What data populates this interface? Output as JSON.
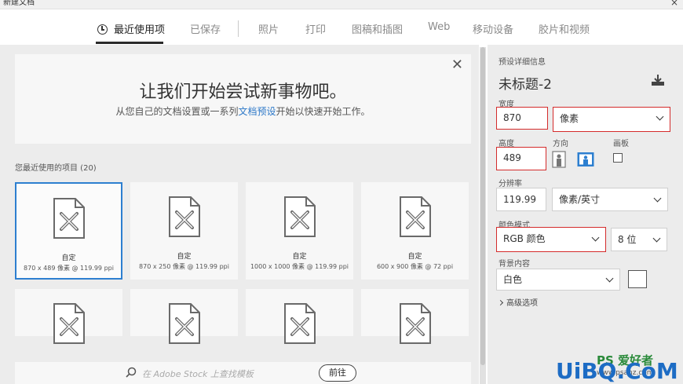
{
  "window": {
    "title": "新建文档",
    "close_glyph": "×"
  },
  "nav": {
    "tabs": [
      {
        "label": "最近使用项",
        "active": true
      },
      {
        "label": "已保存"
      },
      {
        "label": "照片"
      },
      {
        "label": "打印"
      },
      {
        "label": "图稿和插图"
      },
      {
        "label": "Web"
      },
      {
        "label": "移动设备"
      },
      {
        "label": "胶片和视频"
      }
    ]
  },
  "welcome": {
    "heading": "让我们开始尝试新事物吧。",
    "sub_before": "从您自己的文档设置或一系列",
    "sub_link": "文档预设",
    "sub_after": "开始以快速开始工作。",
    "close_glyph": "✕"
  },
  "recent": {
    "label": "您最近使用的项目 (20)",
    "items": [
      {
        "name": "自定",
        "spec": "870 x 489 像素 @ 119.99 ppi",
        "selected": true
      },
      {
        "name": "自定",
        "spec": "870 x 250 像素 @ 119.99 ppi"
      },
      {
        "name": "自定",
        "spec": "1000 x 1000 像素 @ 119.99 ppi"
      },
      {
        "name": "自定",
        "spec": "600 x 900 像素 @ 72 ppi"
      }
    ]
  },
  "search": {
    "placeholder": "在 Adobe Stock 上查找模板",
    "go_label": "前往"
  },
  "details": {
    "section_title": "预设详细信息",
    "doc_name": "未标题-2",
    "width_label": "宽度",
    "width_value": "870",
    "width_unit": "像素",
    "height_label": "高度",
    "height_value": "489",
    "orientation_label": "方向",
    "artboard_label": "画板",
    "resolution_label": "分辨率",
    "resolution_value": "119.99",
    "resolution_unit": "像素/英寸",
    "color_mode_label": "颜色模式",
    "color_mode_value": "RGB 颜色",
    "bit_depth_value": "8 位",
    "background_label": "背景内容",
    "background_value": "白色",
    "advanced_label": "高级选项"
  },
  "watermark": {
    "big": "UiBQ.CoM",
    "ps": "PS 爱好者",
    "url": "www.psahz.com"
  },
  "colors": {
    "accent": "#2d7fd0",
    "highlight_red": "#d42b2b",
    "panel_bg": "#ececec"
  }
}
